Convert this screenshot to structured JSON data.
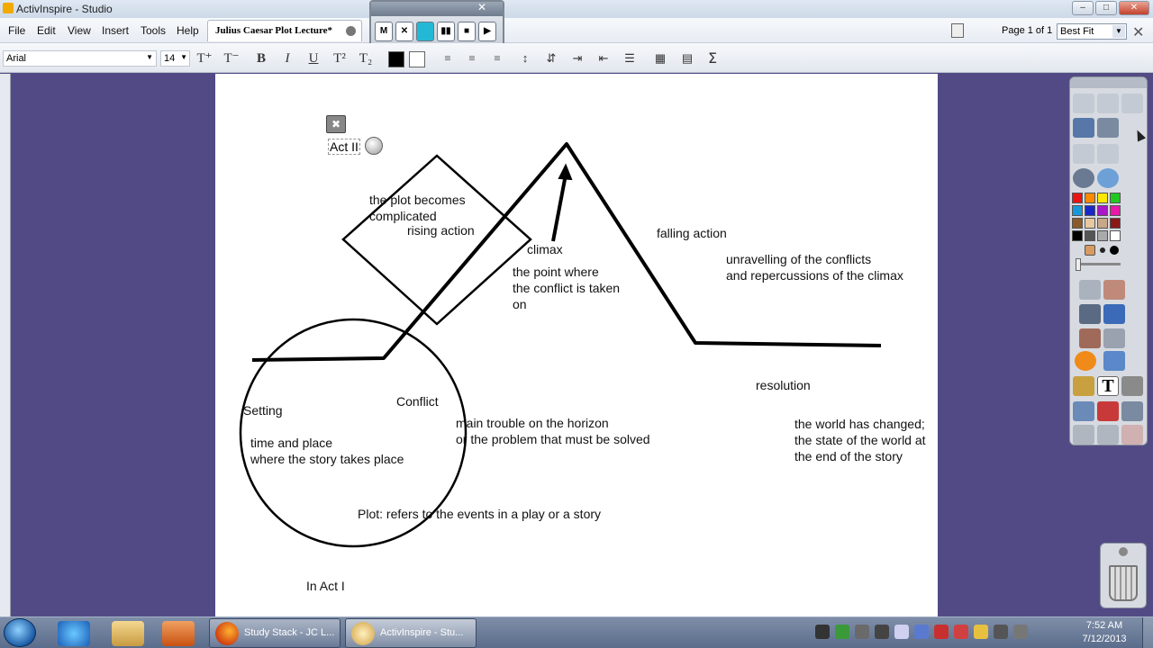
{
  "window": {
    "title": "ActivInspire - Studio",
    "controls": [
      "–",
      "□",
      "✕"
    ]
  },
  "menubar": {
    "items": [
      "File",
      "Edit",
      "View",
      "Insert",
      "Tools",
      "Help"
    ],
    "doc_tab": "Julius Caesar Plot Lecture*",
    "page_info": "Page 1 of 1",
    "zoom": "Best Fit"
  },
  "player": {
    "buttons": [
      "M",
      "✕",
      "",
      "▮▮",
      "■",
      "▶"
    ]
  },
  "format": {
    "font": "Arial",
    "size": "14"
  },
  "canvas": {
    "act_label": "Act II",
    "annotations": {
      "plot_complicated": "the plot becomes\ncomplicated",
      "rising_action": "rising action",
      "climax": "climax",
      "climax_def": "the point where\nthe conflict is taken\non",
      "falling_action": "falling action",
      "falling_def": "unravelling of the conflicts\nand repercussions of the climax",
      "setting": "Setting",
      "conflict": "Conflict",
      "setting_def": "time and place\nwhere the story takes place",
      "conflict_def": "main trouble on the horizon\nor the problem that must be solved",
      "resolution": "resolution",
      "resolution_def": "the world has changed;\nthe state of the world at\nthe end of the story",
      "plot_def": "Plot: refers to the events in a play or a story",
      "act_one": "In Act I"
    }
  },
  "taskbar": {
    "tasks": [
      "Study Stack - JC L...",
      "ActivInspire - Stu..."
    ],
    "time": "7:52 AM",
    "date": "7/12/2013"
  },
  "colors": {
    "workspace": "#524a84",
    "accent": "#23b8d6"
  }
}
